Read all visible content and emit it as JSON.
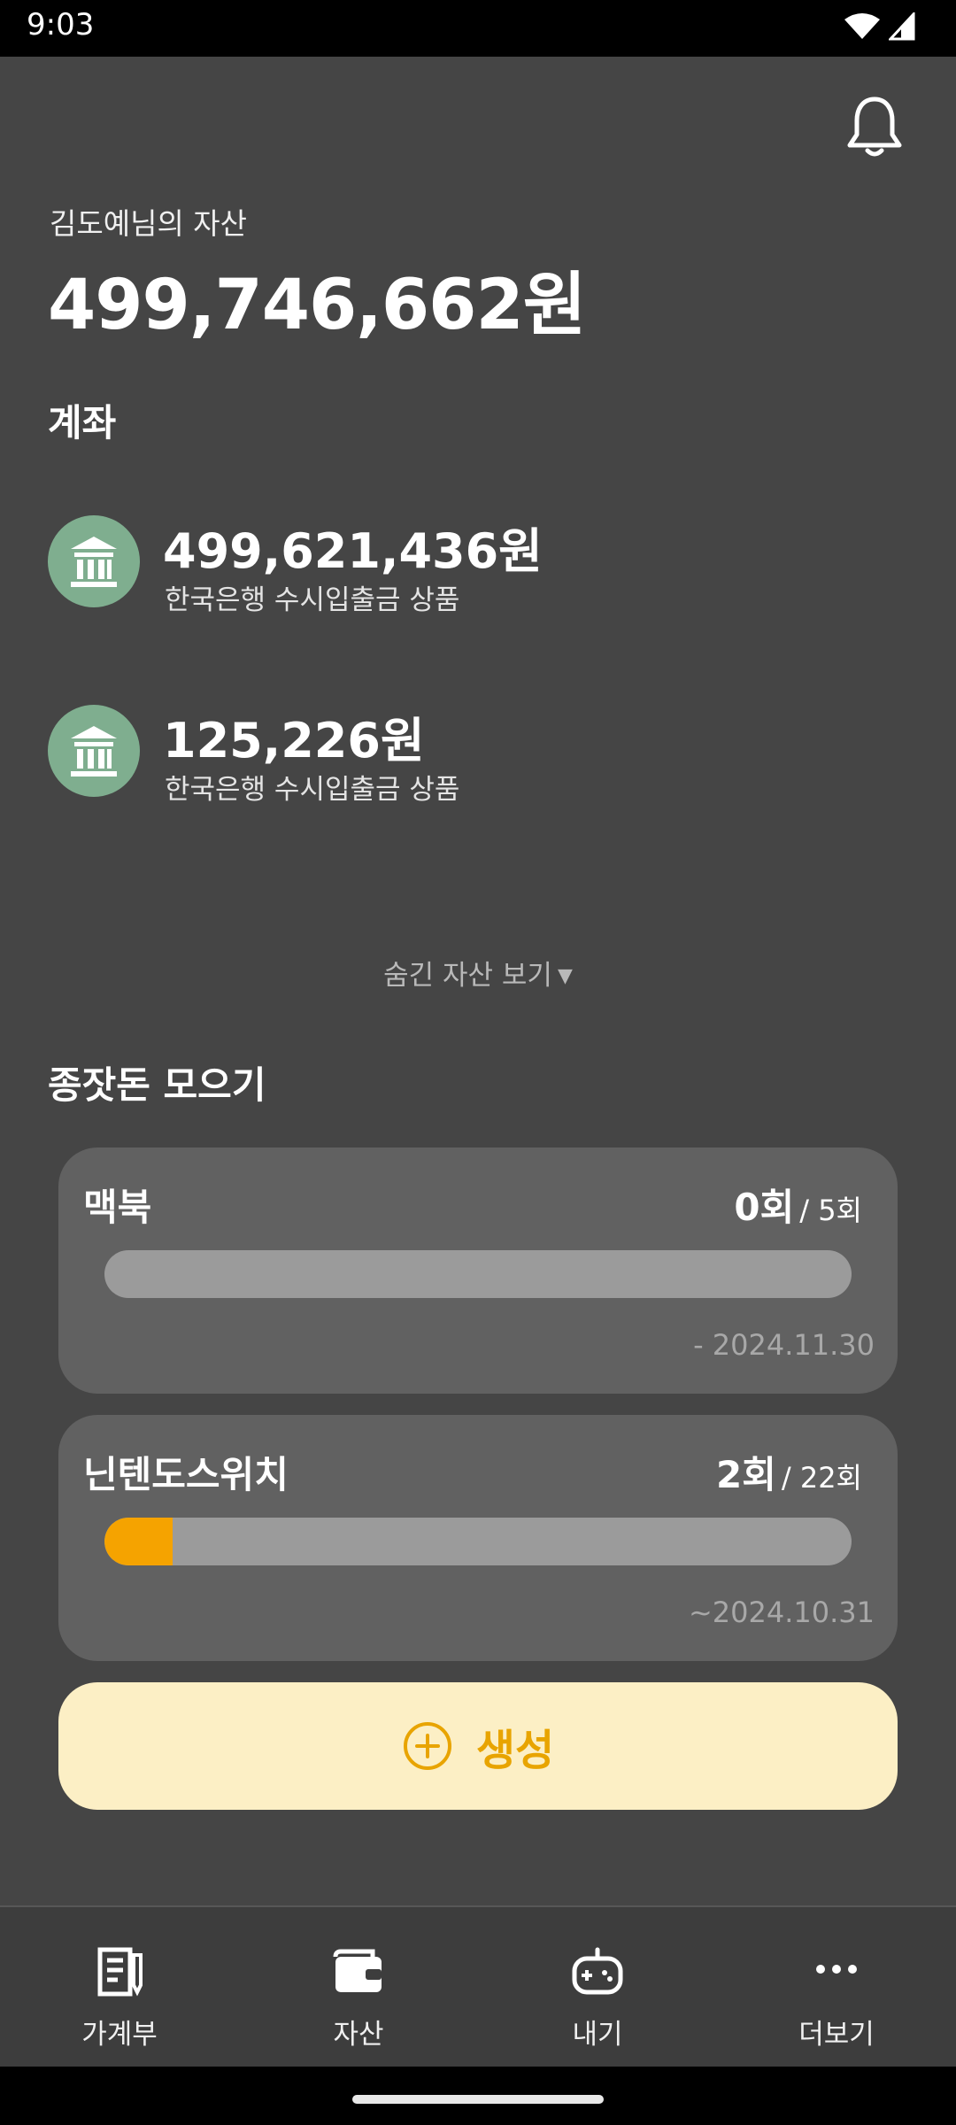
{
  "status_bar": {
    "time": "9:03",
    "icons": [
      "wifi-icon",
      "signal-icon"
    ]
  },
  "header": {
    "owner_label": "김도예님의 자산",
    "total_amount": "499,746,662원",
    "notification_icon": "bell-icon"
  },
  "accounts_section": {
    "title": "계좌",
    "accounts": [
      {
        "amount": "499,621,436원",
        "description": "한국은행 수시입출금 상품",
        "icon": "bank-icon"
      },
      {
        "amount": "125,226원",
        "description": "한국은행 수시입출금 상품",
        "icon": "bank-icon"
      }
    ],
    "hidden_toggle": "숨긴 자산 보기",
    "hidden_toggle_caret": "▼"
  },
  "savings_section": {
    "title": "종잣돈 모으기",
    "goals": [
      {
        "name": "맥북",
        "current": "0회",
        "total": "/ 5회",
        "due": "- 2024.11.30",
        "progress": 0
      },
      {
        "name": "닌텐도스위치",
        "current": "2회",
        "total": "/ 22회",
        "due": "~2024.10.31",
        "progress": 0.0909
      }
    ],
    "create_label": "생성"
  },
  "colors": {
    "background": "#454545",
    "card": "#616161",
    "accent": "#f5a300",
    "create_bg": "#fcefc5",
    "bank_icon_bg": "#7fae8f"
  },
  "bottom_nav": {
    "items": [
      {
        "label": "가계부",
        "icon": "ledger-icon"
      },
      {
        "label": "자산",
        "icon": "wallet-icon"
      },
      {
        "label": "내기",
        "icon": "gamepad-icon"
      },
      {
        "label": "더보기",
        "icon": "more-icon"
      }
    ]
  }
}
